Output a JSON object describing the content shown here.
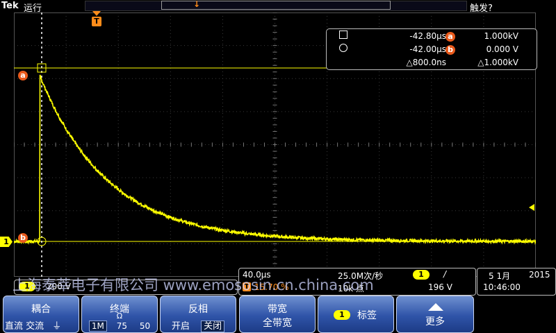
{
  "header": {
    "brand": "Tek",
    "run_state": "运行",
    "trigger_state": "触发?",
    "trigger_marker": "T"
  },
  "markers": {
    "cursor_a": "a",
    "cursor_b": "b",
    "channel": "1"
  },
  "cursor_readout": {
    "row1_time": "-42.80µs",
    "row1_label": "a",
    "row1_value": "1.000kV",
    "row2_time": "-42.00µs",
    "row2_label": "b",
    "row2_value": "0.000 V",
    "delta_time": "△800.0ns",
    "delta_value": "△1.000kV"
  },
  "channel_scale": {
    "channel": "1",
    "volts_per_div": "200 V"
  },
  "horizontal": {
    "time_per_div": "40.0µs",
    "sample_rate": "25.0M次/秒",
    "trigger_channel": "1",
    "trigger_slope": "/",
    "trigger_position_icon": "T",
    "trigger_position": "15.70 %",
    "record_length": "10k 点",
    "trigger_level": "196 V"
  },
  "datetime": {
    "date": "5 1月",
    "year": "2015",
    "time": "10:46:00"
  },
  "menu": {
    "coupling_title": "耦合",
    "coupling_options": "直流 交流",
    "coupling_ground": "⏚",
    "termination_title": "终端",
    "termination_symbol": "Ω",
    "termination_options": [
      "1M",
      "75",
      "50"
    ],
    "invert_title": "反相",
    "invert_on": "开启",
    "invert_off": "关闭",
    "bandwidth_title": "带宽",
    "bandwidth_value": "全带宽",
    "label_channel": "1",
    "label_title": "标签",
    "more_label": "更多"
  },
  "watermark": "上海泰莘电子有限公司 www.emososin.cn.china.com",
  "colors": {
    "trace": "#ffff00",
    "cursor_badge": "#e85a1c",
    "menu": "#2f54a8"
  },
  "waveform": {
    "baseline_v": 0,
    "peak_v": 1000,
    "decay_start_us": -42.8,
    "tau_us": 52,
    "noise_v": 18
  }
}
